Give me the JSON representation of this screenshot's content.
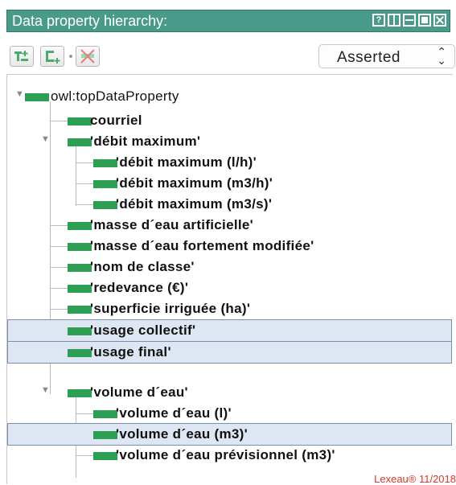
{
  "panel": {
    "title": "Data property hierarchy:",
    "window_controls": [
      "?",
      "split",
      "minimize",
      "maximize",
      "close"
    ]
  },
  "toolbar": {
    "add_sub_icon": "add-subproperty-icon",
    "add_sibling_icon": "add-sibling-property-icon",
    "delete_icon": "delete-property-icon",
    "view_mode": "Asserted"
  },
  "tree": {
    "root": "owl:topDataProperty",
    "items": [
      "courriel",
      "'débit maximum'",
      "'débit maximum (l/h)'",
      "'débit maximum (m3/h)'",
      "'débit maximum (m3/s)'",
      "'masse d´eau artificielle'",
      "'masse d´eau fortement modifiée'",
      "'nom de classe'",
      "'redevance (€)'",
      "'superficie irriguée (ha)'",
      "'usage collectif'",
      "'usage final'",
      "'volume d´eau'",
      "'volume d´eau (l)'",
      "'volume d´eau (m3)'",
      "'volume d´eau prévisionnel (m3)'"
    ]
  },
  "watermark": "Lexeau® 11/2018",
  "colors": {
    "title_bar": "#4a9a8a",
    "property_bar": "#2e9e54",
    "selection": "#dde6f2",
    "watermark": "#d23a2a"
  }
}
